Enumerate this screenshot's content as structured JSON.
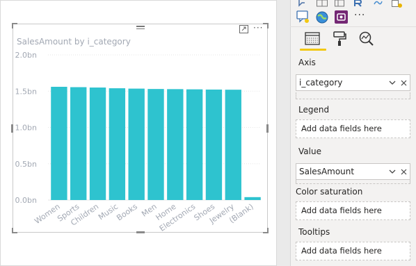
{
  "visual": {
    "title": "SalesAmount by i_category"
  },
  "chart_data": {
    "type": "bar",
    "title": "SalesAmount by i_category",
    "xlabel": "",
    "ylabel": "",
    "categories": [
      "Women",
      "Sports",
      "Children",
      "Music",
      "Books",
      "Men",
      "Home",
      "Electronics",
      "Shoes",
      "Jewelry",
      "(Blank)"
    ],
    "series": [
      {
        "values": [
          1.56,
          1.555,
          1.55,
          1.54,
          1.535,
          1.53,
          1.528,
          1.525,
          1.522,
          1.52,
          0.04
        ]
      }
    ],
    "ylim": [
      0,
      2.0
    ],
    "yticks": [
      0,
      0.5,
      1.0,
      1.5,
      2.0
    ],
    "ytick_labels": [
      "0.0bn",
      "0.5bn",
      "1.0bn",
      "1.5bn",
      "2.0bn"
    ],
    "bar_color": "#2ec3cf",
    "grid": true,
    "legend": "none"
  },
  "fields": {
    "axis": {
      "label": "Axis",
      "value": "i_category"
    },
    "legend": {
      "label": "Legend",
      "placeholder": "Add data fields here"
    },
    "value": {
      "label": "Value",
      "value": "SalesAmount"
    },
    "color_saturation": {
      "label": "Color saturation",
      "placeholder": "Add data fields here"
    },
    "tooltips": {
      "label": "Tooltips",
      "placeholder": "Add data fields here"
    }
  },
  "toolbar": {
    "more_label": "···",
    "more_label_panel": "···"
  },
  "colors": {
    "accent": "#f2c811",
    "bar": "#2ec3cf",
    "tick_text": "#a2a8b3"
  }
}
